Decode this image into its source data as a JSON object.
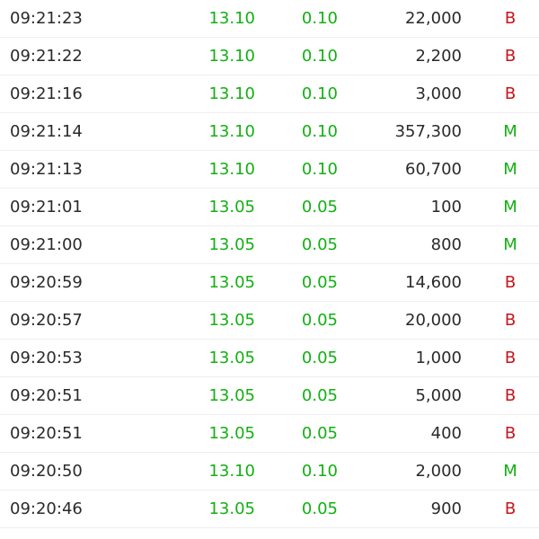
{
  "colors": {
    "up": "#12b012",
    "sell": "#c4161c",
    "buy": "#12b012",
    "text": "#2a2a2a"
  },
  "trades": [
    {
      "time": "09:21:23",
      "price": "13.10",
      "change": "0.10",
      "volume": "22,000",
      "side": "B"
    },
    {
      "time": "09:21:22",
      "price": "13.10",
      "change": "0.10",
      "volume": "2,200",
      "side": "B"
    },
    {
      "time": "09:21:16",
      "price": "13.10",
      "change": "0.10",
      "volume": "3,000",
      "side": "B"
    },
    {
      "time": "09:21:14",
      "price": "13.10",
      "change": "0.10",
      "volume": "357,300",
      "side": "M"
    },
    {
      "time": "09:21:13",
      "price": "13.10",
      "change": "0.10",
      "volume": "60,700",
      "side": "M"
    },
    {
      "time": "09:21:01",
      "price": "13.05",
      "change": "0.05",
      "volume": "100",
      "side": "M"
    },
    {
      "time": "09:21:00",
      "price": "13.05",
      "change": "0.05",
      "volume": "800",
      "side": "M"
    },
    {
      "time": "09:20:59",
      "price": "13.05",
      "change": "0.05",
      "volume": "14,600",
      "side": "B"
    },
    {
      "time": "09:20:57",
      "price": "13.05",
      "change": "0.05",
      "volume": "20,000",
      "side": "B"
    },
    {
      "time": "09:20:53",
      "price": "13.05",
      "change": "0.05",
      "volume": "1,000",
      "side": "B"
    },
    {
      "time": "09:20:51",
      "price": "13.05",
      "change": "0.05",
      "volume": "5,000",
      "side": "B"
    },
    {
      "time": "09:20:51",
      "price": "13.05",
      "change": "0.05",
      "volume": "400",
      "side": "B"
    },
    {
      "time": "09:20:50",
      "price": "13.10",
      "change": "0.10",
      "volume": "2,000",
      "side": "M"
    },
    {
      "time": "09:20:46",
      "price": "13.05",
      "change": "0.05",
      "volume": "900",
      "side": "B"
    }
  ]
}
